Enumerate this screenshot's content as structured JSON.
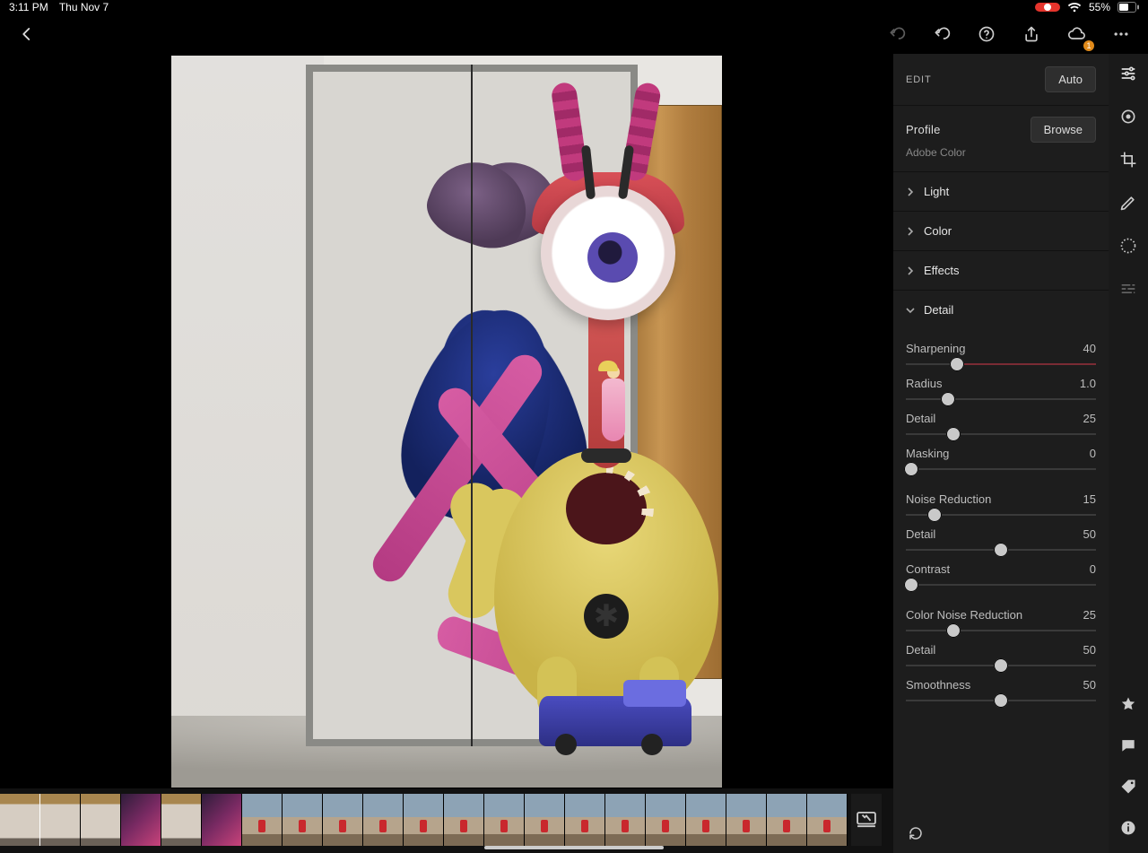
{
  "status": {
    "time": "3:11 PM",
    "date": "Thu Nov 7",
    "battery": "55%"
  },
  "edit": {
    "section_label": "EDIT",
    "auto_label": "Auto",
    "profile_label": "Profile",
    "profile_value": "Adobe Color",
    "browse_label": "Browse",
    "groups": {
      "light": "Light",
      "color": "Color",
      "effects": "Effects",
      "detail": "Detail"
    },
    "sliders": {
      "sharpening": {
        "label": "Sharpening",
        "value": "40",
        "pct": 27,
        "accent_from": 27,
        "accent_to": 100,
        "accent_color": "#7a2b34"
      },
      "radius": {
        "label": "Radius",
        "value": "1.0",
        "pct": 22
      },
      "detail1": {
        "label": "Detail",
        "value": "25",
        "pct": 25
      },
      "masking": {
        "label": "Masking",
        "value": "0",
        "pct": 3
      },
      "noise_reduction": {
        "label": "Noise Reduction",
        "value": "15",
        "pct": 15
      },
      "detail2": {
        "label": "Detail",
        "value": "50",
        "pct": 50
      },
      "contrast": {
        "label": "Contrast",
        "value": "0",
        "pct": 3
      },
      "color_nr": {
        "label": "Color Noise Reduction",
        "value": "25",
        "pct": 25
      },
      "detail3": {
        "label": "Detail",
        "value": "50",
        "pct": 50
      },
      "smoothness": {
        "label": "Smoothness",
        "value": "50",
        "pct": 50
      }
    }
  },
  "cloud_badge": "1"
}
